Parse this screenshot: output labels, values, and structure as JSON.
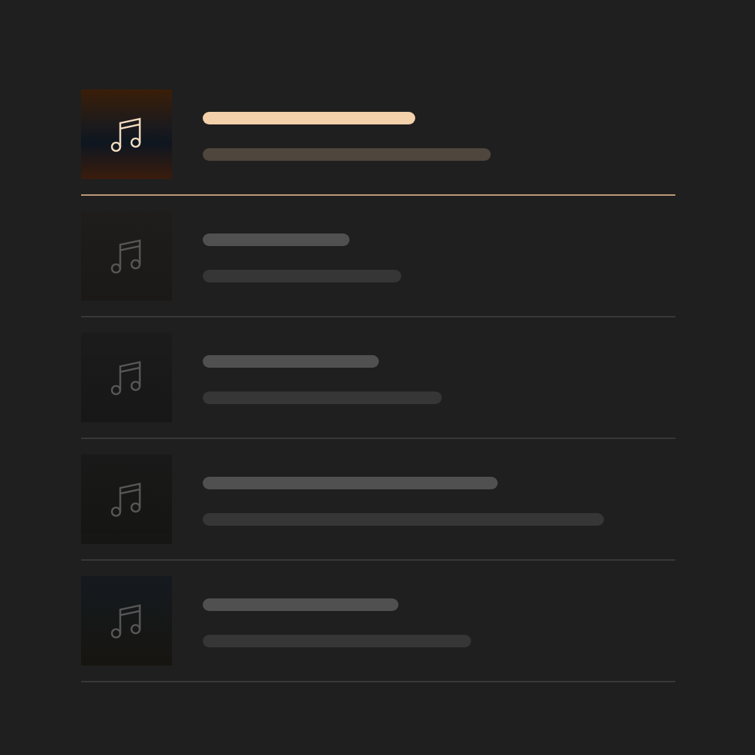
{
  "tracks": [
    {
      "selected": true
    },
    {
      "selected": false
    },
    {
      "selected": false
    },
    {
      "selected": false
    },
    {
      "selected": false
    }
  ]
}
